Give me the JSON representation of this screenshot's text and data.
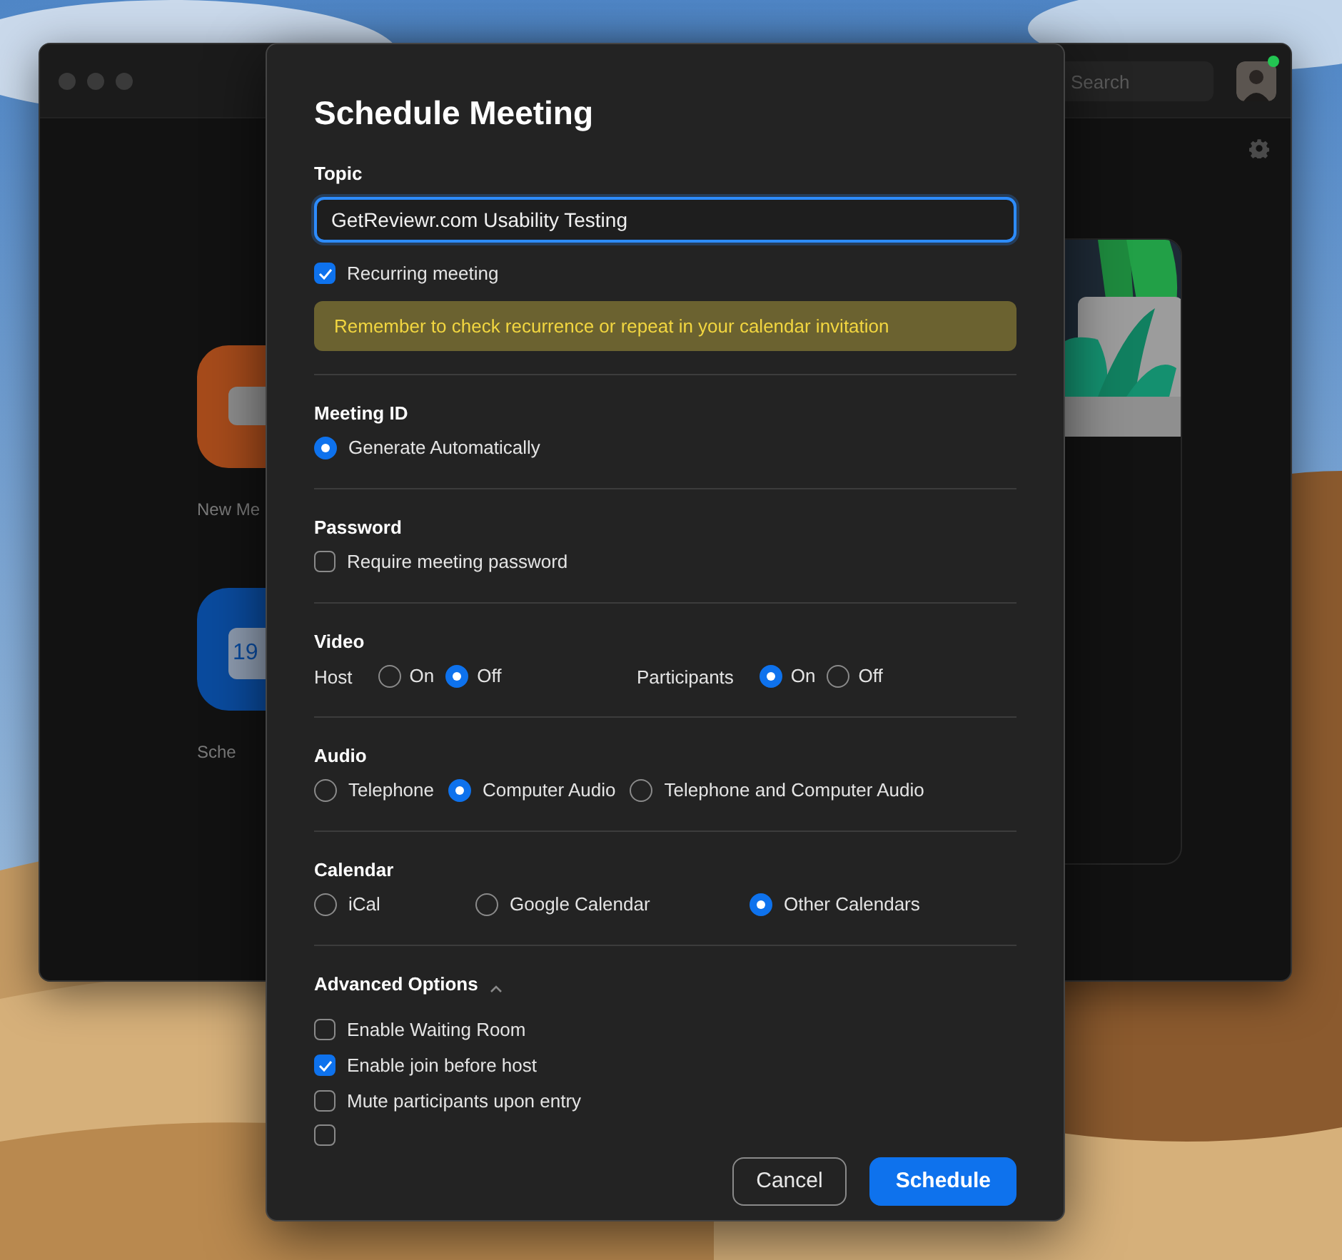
{
  "background_window": {
    "search": {
      "placeholder": "Search"
    },
    "tiles": [
      {
        "kind": "video",
        "label": "New Me"
      },
      {
        "kind": "calendar",
        "label": "Sche",
        "date": "19"
      }
    ]
  },
  "dialog": {
    "title": "Schedule Meeting",
    "topic": {
      "label": "Topic",
      "value": "GetReviewr.com Usability Testing"
    },
    "recurring": {
      "label": "Recurring meeting",
      "checked": true
    },
    "notice": "Remember to check recurrence or repeat in your calendar invitation",
    "sections": [
      {
        "kind": "radio",
        "label": "Meeting ID",
        "options": [
          {
            "label": "Generate Automatically",
            "selected": true
          }
        ]
      },
      {
        "kind": "checkbox",
        "label": "Password",
        "options": [
          {
            "label": "Require meeting password",
            "checked": false
          }
        ]
      },
      {
        "kind": "groups",
        "label": "Video",
        "groups": [
          {
            "label": "Host",
            "options": [
              {
                "label": "On",
                "selected": false
              },
              {
                "label": "Off",
                "selected": true
              }
            ]
          },
          {
            "label": "Participants",
            "options": [
              {
                "label": "On",
                "selected": true
              },
              {
                "label": "Off",
                "selected": false
              }
            ]
          }
        ]
      },
      {
        "kind": "radio",
        "label": "Audio",
        "options": [
          {
            "label": "Telephone",
            "selected": false
          },
          {
            "label": "Computer Audio",
            "selected": true
          },
          {
            "label": "Telephone and Computer Audio",
            "selected": false
          }
        ]
      },
      {
        "kind": "columns",
        "label": "Calendar",
        "options": [
          {
            "label": "iCal",
            "selected": false
          },
          {
            "label": "Google Calendar",
            "selected": false
          },
          {
            "label": "Other Calendars",
            "selected": true
          }
        ]
      }
    ],
    "advanced": {
      "label": "Advanced Options",
      "expanded": true,
      "options": [
        {
          "label": "Enable Waiting Room",
          "checked": false
        },
        {
          "label": "Enable join before host",
          "checked": true
        },
        {
          "label": "Mute participants upon entry",
          "checked": false
        },
        {
          "checked": false
        }
      ]
    },
    "buttons": [
      {
        "kind": "secondary",
        "label": "Cancel"
      },
      {
        "kind": "primary",
        "label": "Schedule"
      }
    ]
  }
}
